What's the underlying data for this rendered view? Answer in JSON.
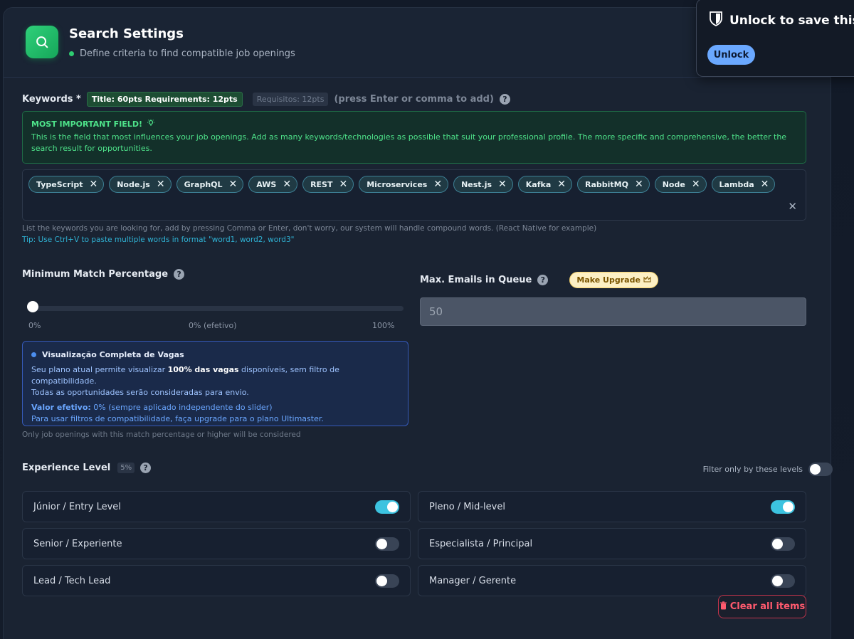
{
  "header": {
    "title": "Search Settings",
    "subtitle": "Define criteria to find compatible job openings",
    "icon": "search-icon"
  },
  "keywords": {
    "label": "Keywords *",
    "score_badge": "Title: 60pts Requirements: 12pts",
    "req_badge": "Requisitos: 12pts",
    "hint": "(press Enter or comma to add)",
    "important_title": "MOST IMPORTANT FIELD!",
    "important_text": "This is the field that most influences your job openings. Add as many keywords/technologies as possible that suit your professional profile. The more specific and comprehensive, the better the search result for opportunities.",
    "tags": [
      "TypeScript",
      "Node.js",
      "GraphQL",
      "AWS",
      "REST",
      "Microservices",
      "Nest.js",
      "Kafka",
      "RabbitMQ",
      "Node",
      "Lambda"
    ],
    "help_text": "List the keywords you are looking for, add by pressing Comma or Enter, don't worry, our system will handle compound words. (React Native for example)",
    "tip_text": "Tip: Use Ctrl+V to paste multiple words in format \"word1, word2, word3\""
  },
  "match": {
    "label": "Minimum Match Percentage",
    "value_percent": 0,
    "min_label": "0%",
    "mid_label": "0% (efetivo)",
    "max_label": "100%",
    "info_title": "Visualização Completa de Vagas",
    "info_text_pre": "Seu plano atual permite visualizar ",
    "info_text_bold": "100% das vagas",
    "info_text_post": " disponíveis, sem filtro de compatibilidade.",
    "info_text_line2": "Todas as oportunidades serão consideradas para envio.",
    "info_eff_label": "Valor efetivo:",
    "info_eff_value": " 0% (sempre aplicado independente do slider)",
    "info_upgrade": "Para usar filtros de compatibilidade, faça upgrade para o plano Ultimaster.",
    "note": "Only job openings with this match percentage or higher will be considered"
  },
  "emails": {
    "label": "Max. Emails in Queue",
    "upgrade_label": "Make Upgrade",
    "value": "50"
  },
  "experience": {
    "label": "Experience Level",
    "badge": "5%",
    "filter_label": "Filter only by these levels",
    "filter_on": false,
    "levels": [
      {
        "label": "Júnior / Entry Level",
        "on": true
      },
      {
        "label": "Pleno / Mid-level",
        "on": true
      },
      {
        "label": "Senior / Experiente",
        "on": false
      },
      {
        "label": "Especialista / Principal",
        "on": false
      },
      {
        "label": "Lead / Tech Lead",
        "on": false
      },
      {
        "label": "Manager / Gerente",
        "on": false
      }
    ],
    "clear_label": "Clear all items"
  },
  "popup": {
    "title": "Unlock to save this log",
    "button": "Unlock"
  }
}
